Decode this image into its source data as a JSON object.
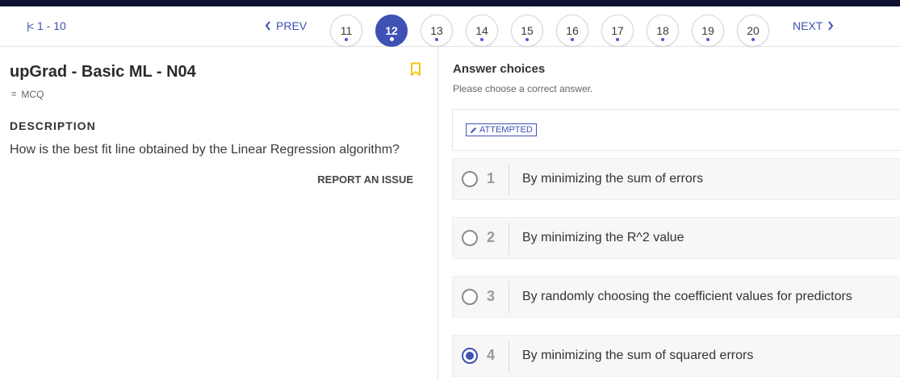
{
  "pager": {
    "range_label": "1 - 10",
    "prev_label": "PREV",
    "next_label": "NEXT",
    "pages": [
      "11",
      "12",
      "13",
      "14",
      "15",
      "16",
      "17",
      "18",
      "19",
      "20"
    ],
    "active_page": "12"
  },
  "question": {
    "title": "upGrad - Basic ML - N04",
    "type": "MCQ",
    "description_heading": "DESCRIPTION",
    "description": "How is the best fit line obtained by the Linear Regression algorithm?",
    "report_label": "REPORT AN ISSUE"
  },
  "answers": {
    "heading": "Answer choices",
    "subheading": "Please choose a correct answer.",
    "status_badge": "ATTEMPTED",
    "choices": [
      {
        "num": "1",
        "text": "By minimizing the sum of errors",
        "selected": false
      },
      {
        "num": "2",
        "text": "By minimizing the R^2 value",
        "selected": false
      },
      {
        "num": "3",
        "text": "By randomly choosing the coefficient values for predictors",
        "selected": false
      },
      {
        "num": "4",
        "text": "By minimizing the sum of squared errors",
        "selected": true
      }
    ]
  },
  "colors": {
    "accent": "#3f51b5",
    "topbar": "#0e1230",
    "bookmark": "#f5c518"
  },
  "icons": {
    "first_page": "first-page-icon",
    "prev": "chevron-left-icon",
    "next": "chevron-right-icon",
    "bookmark": "bookmark-icon",
    "type": "menu-lines-icon",
    "badge": "pencil-icon"
  }
}
